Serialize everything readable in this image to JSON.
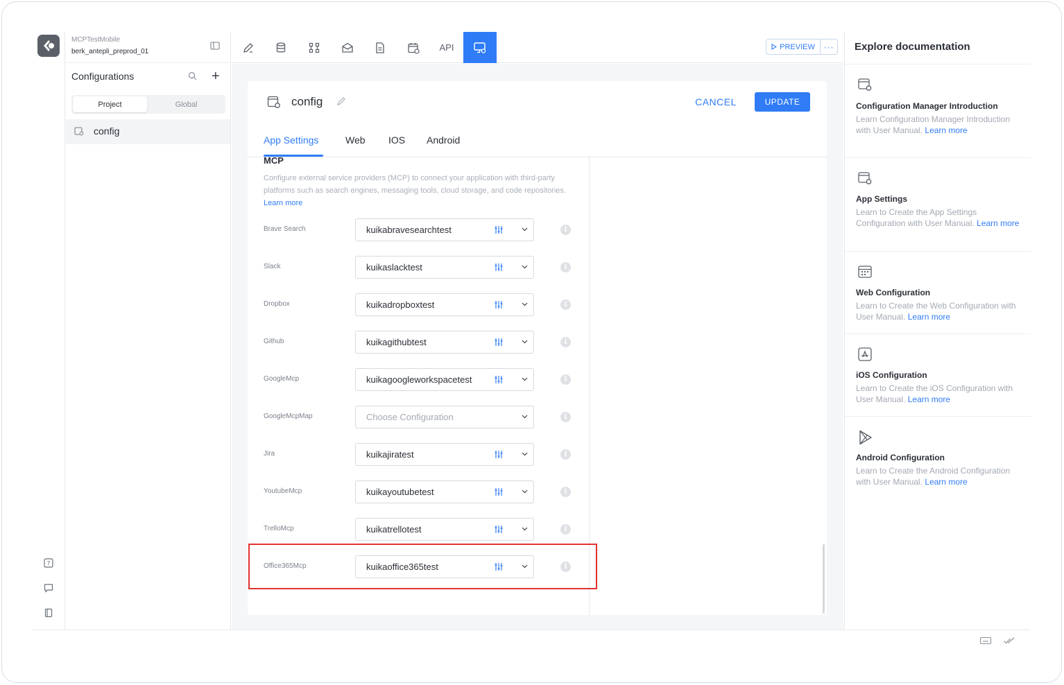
{
  "sidebar": {
    "project_name": "MCPTestMobile",
    "branch_name": "berk_antepli_preprod_01",
    "section_title": "Configurations",
    "scope_tabs": [
      "Project",
      "Global"
    ],
    "active_scope": "Project",
    "items": [
      {
        "label": "config"
      }
    ]
  },
  "toolbar": {
    "tools": [
      "design-icon",
      "database-icon",
      "workflow-icon",
      "mail-icon",
      "document-icon",
      "calendar-icon",
      "API",
      "configuration-icon"
    ],
    "api_label": "API",
    "active_tool": "configuration-icon",
    "preview_label": "PREVIEW",
    "more_label": "···"
  },
  "editor": {
    "title": "config",
    "cancel_label": "CANCEL",
    "update_label": "UPDATE",
    "tabs": [
      {
        "label": "App Settings"
      },
      {
        "label": "Web"
      },
      {
        "label": "IOS"
      },
      {
        "label": "Android"
      }
    ],
    "active_tab": "App Settings",
    "section": {
      "title": "MCP",
      "description": "Configure external service providers (MCP) to connect your application with third-party platforms such as search engines, messaging tools, cloud storage, and code repositories.",
      "learn_more": "Learn more"
    },
    "rows": [
      {
        "label": "Brave Search",
        "value": "kuikabravesearchtest"
      },
      {
        "label": "Slack",
        "value": "kuikaslacktest"
      },
      {
        "label": "Dropbox",
        "value": "kuikadropboxtest"
      },
      {
        "label": "Github",
        "value": "kuikagithubtest"
      },
      {
        "label": "GoogleMcp",
        "value": "kuikagoogleworkspacetest"
      },
      {
        "label": "GoogleMcpMap",
        "value": "",
        "placeholder": "Choose Configuration"
      },
      {
        "label": "Jira",
        "value": "kuikajiratest"
      },
      {
        "label": "YoutubeMcp",
        "value": "kuikayoutubetest"
      },
      {
        "label": "TrelloMcp",
        "value": "kuikatrellotest"
      },
      {
        "label": "Office365Mcp",
        "value": "kuikaoffice365test",
        "highlighted": true
      }
    ],
    "info_glyph": "i"
  },
  "docs": {
    "title": "Explore documentation",
    "learn_more": "Learn more",
    "items": [
      {
        "title": "Configuration Manager Introduction",
        "desc": "Learn Configuration Manager Introduction with User Manual.",
        "icon": "config-file-icon"
      },
      {
        "title": "App Settings",
        "desc": "Learn to Create the App Settings Configuration with User Manual.",
        "icon": "config-file-icon"
      },
      {
        "title": "Web Configuration",
        "desc": "Learn to Create the Web Configuration with User Manual.",
        "icon": "calendar-grid-icon"
      },
      {
        "title": "iOS Configuration",
        "desc": "Learn to Create the iOS Configuration with User Manual.",
        "icon": "app-store-icon"
      },
      {
        "title": "Android Configuration",
        "desc": "Learn to Create the Android Configuration with User Manual.",
        "icon": "play-store-icon"
      }
    ]
  },
  "colors": {
    "accent": "#2f7cf6",
    "highlight_border": "#e0332e"
  }
}
